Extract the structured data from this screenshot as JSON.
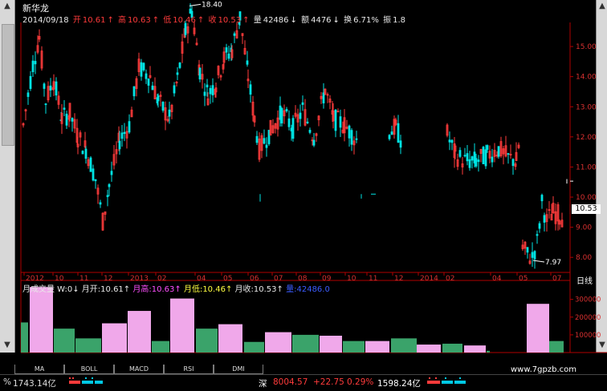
{
  "stock": {
    "name": "新华龙"
  },
  "header": {
    "date": "2014/09/18",
    "open_label": "开",
    "open": "10.61",
    "high_label": "高",
    "high": "10.63",
    "low_label": "低",
    "low": "10.46",
    "close_label": "收",
    "close": "10.53",
    "vol_label": "量",
    "vol": "42486",
    "amt_label": "额",
    "amt": "4476",
    "turnover_label": "换",
    "turnover": "6.71%",
    "amp_label": "振",
    "amp": "1.8"
  },
  "price_axis": {
    "labels": [
      "15.00",
      "14.00",
      "13.00",
      "12.00",
      "11.00",
      "10.00",
      "9.00",
      "8.00"
    ],
    "current": "10.53"
  },
  "annotations": {
    "max": "18.40",
    "min": "7.97"
  },
  "time_axis": [
    "2012",
    "10",
    "11",
    "12",
    "2013",
    "02",
    "04",
    "05",
    "06",
    "07",
    "08",
    "09",
    "10",
    "11",
    "12",
    "2014",
    "02",
    "04",
    "05",
    "07"
  ],
  "period_label": "日线",
  "volume_panel": {
    "legend_prefix": "月成交量 W:0",
    "open_label": "月开:10.61",
    "high_label": "月高:10.63",
    "low_label": "月低:10.46",
    "close_label": "月收:10.53",
    "vol_label": "量:42486.0",
    "axis_labels": [
      "300000",
      "200000",
      "100000"
    ]
  },
  "tabs": [
    "MA",
    "BOLL",
    "MACD",
    "RSI",
    "DMI"
  ],
  "status": {
    "left_pct": "%",
    "left_amount": "1743.14亿",
    "market_name": "深",
    "index_value": "8004.57",
    "index_change": "+22.75",
    "index_pct": "0.29%",
    "market_amount": "1598.24亿"
  },
  "watermark": "www.7gpzb.com",
  "colors": {
    "up": "#ff3b3b",
    "down": "#00e4e4",
    "ma": "#ffffff",
    "vol_up": "#f0a8ea",
    "vol_down": "#3aa36a"
  },
  "chart_data": {
    "type": "candlestick",
    "price_range": [
      7.5,
      15.8
    ],
    "monthly_volume": [
      170000,
      370000,
      135000,
      80000,
      165000,
      235000,
      65000,
      305000,
      135000,
      160000,
      60000,
      115000,
      100000,
      95000,
      65000,
      65000,
      80000,
      45000,
      50000,
      40000,
      10000,
      275000,
      65000
    ]
  }
}
